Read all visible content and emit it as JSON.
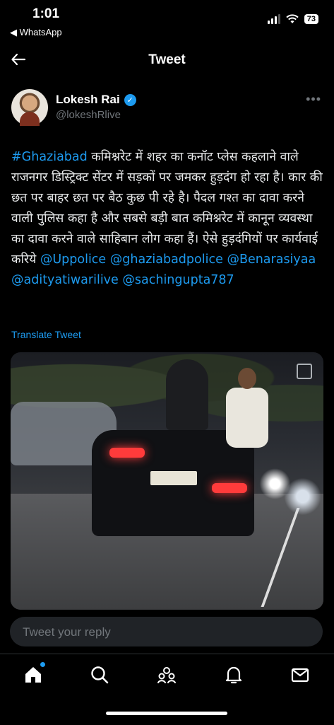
{
  "status": {
    "time": "1:01",
    "back_app": "◀ WhatsApp",
    "battery": "73"
  },
  "header": {
    "title": "Tweet"
  },
  "author": {
    "name": "Lokesh Rai",
    "handle": "@lokeshRlive"
  },
  "tweet": {
    "hashtag": "#Ghaziabad",
    "text": " कमिश्नरेट में शहर का कनॉट प्लेस कहलाने वाले राजनगर डिस्ट्रिक्ट सेंटर में सड़कों पर जमकर हुड़दंग हो रहा है। कार की छत पर बाहर छत पर बैठ कुछ पी रहे है। पैदल गश्त का दावा करने वाली पुलिस कहा है और सबसे बड़ी बात कमिश्नरेट में कानून व्यवस्था का दावा करने वाले साहिबान लोग कहा हैं। ऐसे हुड़दंगियों पर कार्यवाई करिये ",
    "mentions": [
      "@Uppolice",
      "@ghaziabadpolice",
      "@Benarasiyaa",
      "@adityatiwarilive",
      "@sachingupta787"
    ]
  },
  "translate_label": "Translate Tweet",
  "reply": {
    "placeholder": "Tweet your reply"
  },
  "tabs": [
    "home-icon",
    "search-icon",
    "communities-icon",
    "notifications-icon",
    "messages-icon"
  ],
  "colors": {
    "accent": "#1d9bf0",
    "background": "#000000"
  }
}
